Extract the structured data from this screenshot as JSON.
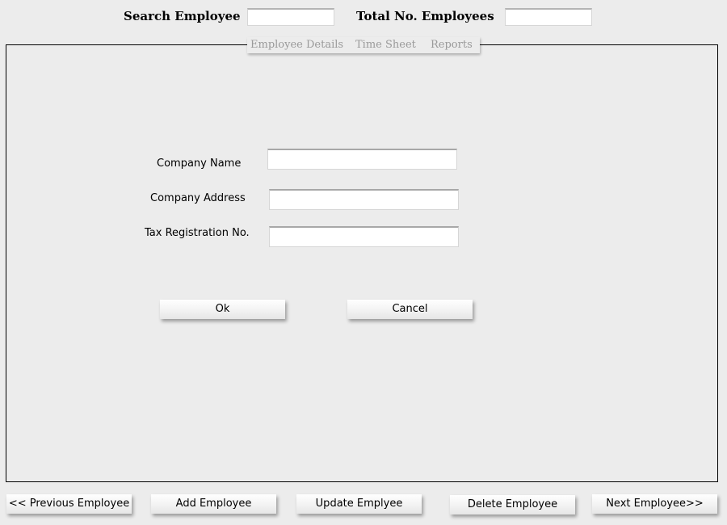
{
  "header": {
    "search_label": "Search Employee",
    "search_value": "",
    "total_label": "Total No. Employees",
    "total_value": ""
  },
  "tabs": [
    {
      "label": "Employee Details"
    },
    {
      "label": "Time Sheet"
    },
    {
      "label": "Reports"
    }
  ],
  "form": {
    "company_name_label": "Company Name",
    "company_name_value": "",
    "company_address_label": "Company Address",
    "company_address_value": "",
    "tax_reg_label": "Tax Registration No.",
    "tax_reg_value": "",
    "ok_label": "Ok",
    "cancel_label": "Cancel"
  },
  "footer": {
    "previous_label": "<< Previous Employee",
    "add_label": "Add Employee",
    "update_label": "Update Emplyee",
    "delete_label": "Delete Employee",
    "next_label": "Next Employee>>"
  },
  "colors": {
    "background": "#ececec",
    "tab_text": "#9a9a9a",
    "panel_border": "#000000"
  }
}
